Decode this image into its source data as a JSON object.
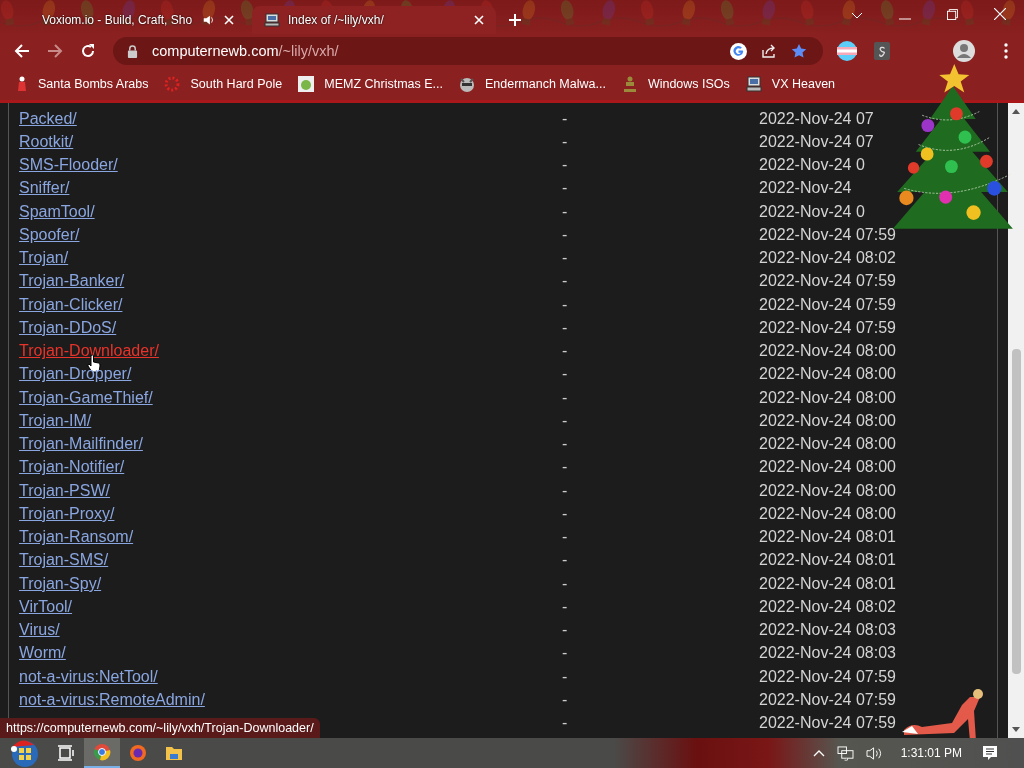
{
  "browser": {
    "tabs": [
      {
        "title": "Voxiom.io - Build, Craft, Sho",
        "selected": false,
        "audio": true
      },
      {
        "title": "Index of /~lily/vxh/",
        "selected": true,
        "audio": false
      }
    ],
    "address": {
      "domain": "computernewb.com",
      "path": "/~lily/vxh/"
    },
    "bookmarks": [
      {
        "label": "Santa Bombs Arabs"
      },
      {
        "label": "South Hard Pole"
      },
      {
        "label": "MEMZ Christmas E..."
      },
      {
        "label": "Endermanch Malwa..."
      },
      {
        "label": "Windows ISOs"
      },
      {
        "label": "VX Heaven"
      }
    ],
    "status_url": "https://computernewb.com/~lily/vxh/Trojan-Downloader/"
  },
  "listing": {
    "rows": [
      {
        "name": "Packed/",
        "size": "-",
        "modified": "2022-Nov-24 07",
        "hovered": false
      },
      {
        "name": "Rootkit/",
        "size": "-",
        "modified": "2022-Nov-24 07",
        "hovered": false
      },
      {
        "name": "SMS-Flooder/",
        "size": "-",
        "modified": "2022-Nov-24 0",
        "hovered": false
      },
      {
        "name": "Sniffer/",
        "size": "-",
        "modified": "2022-Nov-24",
        "hovered": false
      },
      {
        "name": "SpamTool/",
        "size": "-",
        "modified": "2022-Nov-24 0",
        "hovered": false
      },
      {
        "name": "Spoofer/",
        "size": "-",
        "modified": "2022-Nov-24 07:59",
        "hovered": false
      },
      {
        "name": "Trojan/",
        "size": "-",
        "modified": "2022-Nov-24 08:02",
        "hovered": false
      },
      {
        "name": "Trojan-Banker/",
        "size": "-",
        "modified": "2022-Nov-24 07:59",
        "hovered": false
      },
      {
        "name": "Trojan-Clicker/",
        "size": "-",
        "modified": "2022-Nov-24 07:59",
        "hovered": false
      },
      {
        "name": "Trojan-DDoS/",
        "size": "-",
        "modified": "2022-Nov-24 07:59",
        "hovered": false
      },
      {
        "name": "Trojan-Downloader/",
        "size": "-",
        "modified": "2022-Nov-24 08:00",
        "hovered": true
      },
      {
        "name": "Trojan-Dropper/",
        "size": "-",
        "modified": "2022-Nov-24 08:00",
        "hovered": false
      },
      {
        "name": "Trojan-GameThief/",
        "size": "-",
        "modified": "2022-Nov-24 08:00",
        "hovered": false
      },
      {
        "name": "Trojan-IM/",
        "size": "-",
        "modified": "2022-Nov-24 08:00",
        "hovered": false
      },
      {
        "name": "Trojan-Mailfinder/",
        "size": "-",
        "modified": "2022-Nov-24 08:00",
        "hovered": false
      },
      {
        "name": "Trojan-Notifier/",
        "size": "-",
        "modified": "2022-Nov-24 08:00",
        "hovered": false
      },
      {
        "name": "Trojan-PSW/",
        "size": "-",
        "modified": "2022-Nov-24 08:00",
        "hovered": false
      },
      {
        "name": "Trojan-Proxy/",
        "size": "-",
        "modified": "2022-Nov-24 08:00",
        "hovered": false
      },
      {
        "name": "Trojan-Ransom/",
        "size": "-",
        "modified": "2022-Nov-24 08:01",
        "hovered": false
      },
      {
        "name": "Trojan-SMS/",
        "size": "-",
        "modified": "2022-Nov-24 08:01",
        "hovered": false
      },
      {
        "name": "Trojan-Spy/",
        "size": "-",
        "modified": "2022-Nov-24 08:01",
        "hovered": false
      },
      {
        "name": "VirTool/",
        "size": "-",
        "modified": "2022-Nov-24 08:02",
        "hovered": false
      },
      {
        "name": "Virus/",
        "size": "-",
        "modified": "2022-Nov-24 08:03",
        "hovered": false
      },
      {
        "name": "Worm/",
        "size": "-",
        "modified": "2022-Nov-24 08:03",
        "hovered": false
      },
      {
        "name": "not-a-virus:NetTool/",
        "size": "-",
        "modified": "2022-Nov-24 07:59",
        "hovered": false
      },
      {
        "name": "not-a-virus:RemoteAdmin/",
        "size": "-",
        "modified": "2022-Nov-24 07:59",
        "hovered": false
      },
      {
        "size": "-",
        "modified": "2022-Nov-24 07:59"
      }
    ]
  },
  "taskbar": {
    "apps": [
      {
        "kind": "task-view",
        "selected": false
      },
      {
        "kind": "chrome",
        "selected": true
      },
      {
        "kind": "firefox",
        "selected": false
      },
      {
        "kind": "explorer",
        "selected": false
      }
    ],
    "clock": "1:31:01 PM"
  }
}
